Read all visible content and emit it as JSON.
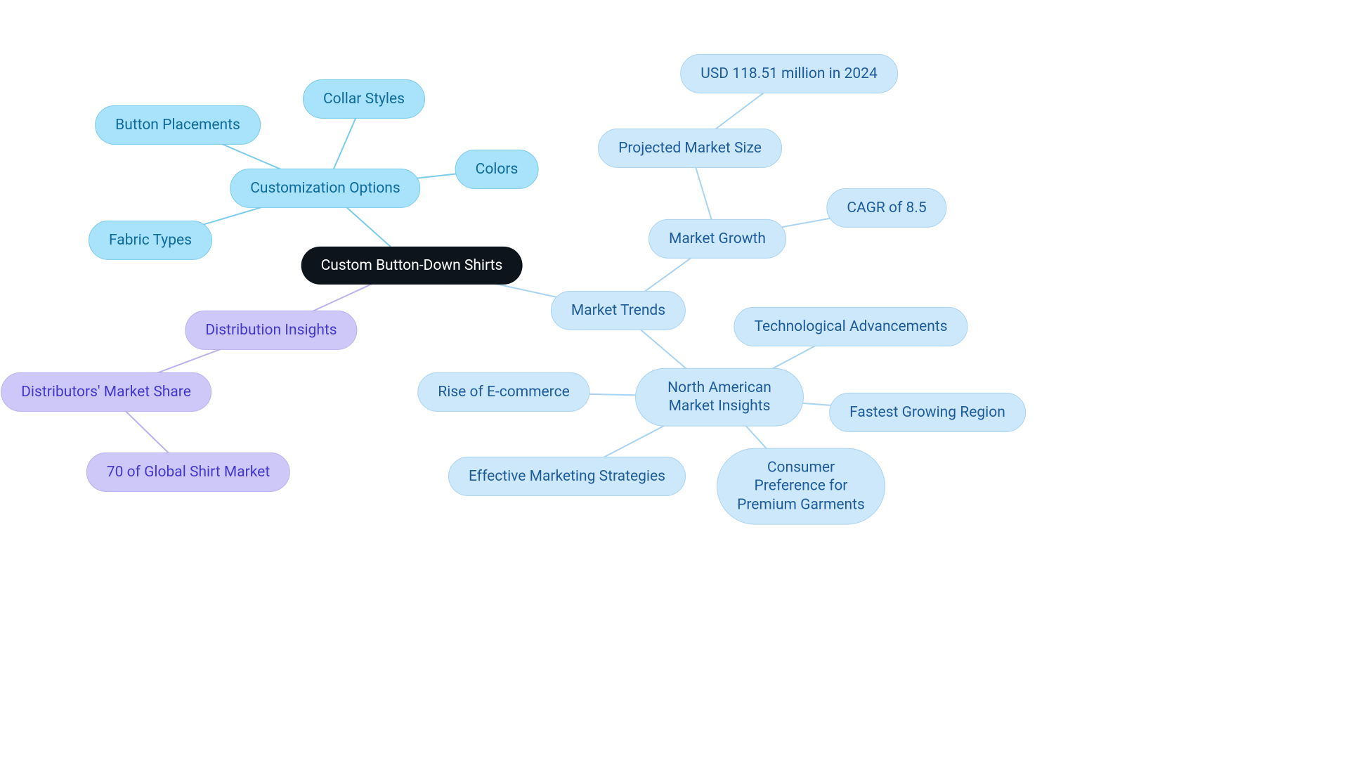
{
  "root": {
    "label": "Custom Button-Down Shirts"
  },
  "customization": {
    "label": "Customization Options",
    "children": {
      "button_placements": "Button Placements",
      "collar_styles": "Collar Styles",
      "colors": "Colors",
      "fabric_types": "Fabric Types"
    }
  },
  "distribution": {
    "label": "Distribution Insights",
    "market_share": "Distributors' Market Share",
    "global_70": "70 of Global Shirt Market"
  },
  "market_trends": {
    "label": "Market Trends",
    "growth": {
      "label": "Market Growth",
      "projected_size": "Projected Market Size",
      "usd": "USD 118.51 million in 2024",
      "cagr": "CAGR of 8.5"
    },
    "na_insights": {
      "label": "North American Market Insights",
      "ecommerce": "Rise of E-commerce",
      "tech": "Technological Advancements",
      "fastest": "Fastest Growing Region",
      "marketing": "Effective Marketing Strategies",
      "premium": "Consumer Preference for Premium Garments"
    }
  }
}
